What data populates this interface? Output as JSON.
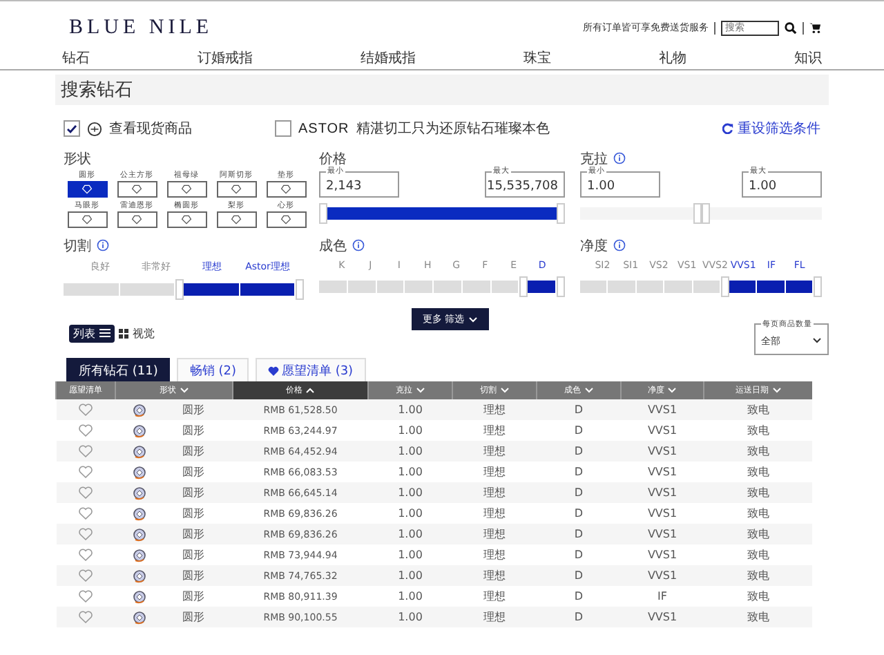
{
  "header": {
    "logo": "BLUE NILE",
    "promo": "所有订单皆可享免费送货服务",
    "search": {
      "placeholder": "搜索"
    }
  },
  "nav": [
    "钻石",
    "订婚戒指",
    "结婚戒指",
    "珠宝",
    "礼物",
    "知识"
  ],
  "page_title": "搜索钻石",
  "options": [
    {
      "kind": "in-stock",
      "label": "查看现货商品",
      "checked": true
    },
    {
      "kind": "astor",
      "brand": "ASTOR",
      "label": "精湛切工只为还原钻石璀璨本色",
      "checked": false
    }
  ],
  "reset": "重设筛选条件",
  "shape": {
    "label": "形状",
    "items": [
      {
        "label": "圆形",
        "selected": true
      },
      {
        "label": "公主方形",
        "selected": false
      },
      {
        "label": "祖母绿",
        "selected": false
      },
      {
        "label": "阿斯切形",
        "selected": false
      },
      {
        "label": "垫形",
        "selected": false
      },
      {
        "label": "马眼形",
        "selected": false
      },
      {
        "label": "雷迪恩形",
        "selected": false
      },
      {
        "label": "椭圆形",
        "selected": false
      },
      {
        "label": "梨形",
        "selected": false
      },
      {
        "label": "心形",
        "selected": false
      }
    ]
  },
  "price": {
    "label": "价格",
    "min_label": "最小",
    "min": "2,143",
    "max_label": "最大",
    "max": "15,535,708",
    "level": 1
  },
  "carat": {
    "label": "克拉",
    "min_label": "最小",
    "min": "1.00",
    "max_label": "最大",
    "max": "1.00"
  },
  "cut": {
    "label": "切割",
    "grades": [
      {
        "label": "良好",
        "selected": false
      },
      {
        "label": "非常好",
        "selected": false
      },
      {
        "label": "理想",
        "selected": true
      },
      {
        "label": "Astor理想",
        "selected": true
      }
    ]
  },
  "color": {
    "label": "成色",
    "grades": [
      {
        "label": "K",
        "selected": false
      },
      {
        "label": "J",
        "selected": false
      },
      {
        "label": "I",
        "selected": false
      },
      {
        "label": "H",
        "selected": false
      },
      {
        "label": "G",
        "selected": false
      },
      {
        "label": "F",
        "selected": false
      },
      {
        "label": "E",
        "selected": false
      },
      {
        "label": "D",
        "selected": true
      }
    ]
  },
  "clarity": {
    "label": "净度",
    "grades": [
      {
        "label": "SI2",
        "selected": false
      },
      {
        "label": "SI1",
        "selected": false
      },
      {
        "label": "VS2",
        "selected": false
      },
      {
        "label": "VS1",
        "selected": false
      },
      {
        "label": "VVS2",
        "selected": false
      },
      {
        "label": "VVS1",
        "selected": true
      },
      {
        "label": "IF",
        "selected": true
      },
      {
        "label": "FL",
        "selected": true
      }
    ]
  },
  "views": [
    {
      "label": "列表",
      "selected": true
    },
    {
      "label": "视觉",
      "selected": false
    }
  ],
  "more_filters": "更多 筛选",
  "per_page": {
    "label": "每页商品数量",
    "value": "全部"
  },
  "tabs": [
    {
      "label": "所有钻石 (11)",
      "selected": true,
      "kind": "plain"
    },
    {
      "label": "畅销 (2)",
      "selected": false,
      "kind": "plain"
    },
    {
      "label": "愿望清单 (3)",
      "selected": false,
      "kind": "wishlist"
    }
  ],
  "table": {
    "columns": [
      {
        "label": "愿望清单",
        "sorted": false,
        "sortable": false
      },
      {
        "label": "形状",
        "sorted": false,
        "sortable": true
      },
      {
        "label": "价格",
        "sorted": true,
        "sortable": true
      },
      {
        "label": "克拉",
        "sorted": false,
        "sortable": true
      },
      {
        "label": "切割",
        "sorted": false,
        "sortable": true
      },
      {
        "label": "成色",
        "sorted": false,
        "sortable": true
      },
      {
        "label": "净度",
        "sorted": false,
        "sortable": true
      },
      {
        "label": "运送日期",
        "sorted": false,
        "sortable": true
      }
    ],
    "rows": [
      [
        "",
        "圆形",
        "RMB 61,528.50",
        "1.00",
        "理想",
        "D",
        "VVS1",
        "致电"
      ],
      [
        "",
        "圆形",
        "RMB 63,244.97",
        "1.00",
        "理想",
        "D",
        "VVS1",
        "致电"
      ],
      [
        "",
        "圆形",
        "RMB 64,452.94",
        "1.00",
        "理想",
        "D",
        "VVS1",
        "致电"
      ],
      [
        "",
        "圆形",
        "RMB 66,083.53",
        "1.00",
        "理想",
        "D",
        "VVS1",
        "致电"
      ],
      [
        "",
        "圆形",
        "RMB 66,645.14",
        "1.00",
        "理想",
        "D",
        "VVS1",
        "致电"
      ],
      [
        "",
        "圆形",
        "RMB 69,836.26",
        "1.00",
        "理想",
        "D",
        "VVS1",
        "致电"
      ],
      [
        "",
        "圆形",
        "RMB 69,836.26",
        "1.00",
        "理想",
        "D",
        "VVS1",
        "致电"
      ],
      [
        "",
        "圆形",
        "RMB 73,944.94",
        "1.00",
        "理想",
        "D",
        "VVS1",
        "致电"
      ],
      [
        "",
        "圆形",
        "RMB 74,765.32",
        "1.00",
        "理想",
        "D",
        "VVS1",
        "致电"
      ],
      [
        "",
        "圆形",
        "RMB 80,911.39",
        "1.00",
        "理想",
        "D",
        "IF",
        "致电"
      ],
      [
        "",
        "圆形",
        "RMB 90,100.55",
        "1.00",
        "理想",
        "D",
        "VVS1",
        "致电"
      ]
    ]
  }
}
